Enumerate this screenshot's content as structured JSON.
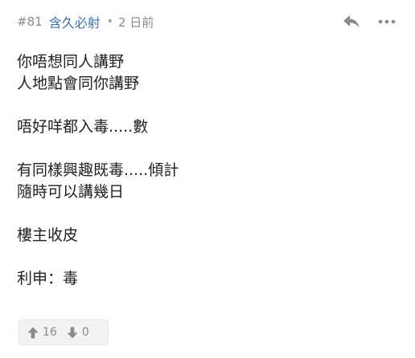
{
  "post": {
    "number": "#81",
    "username": "含久必射",
    "separator": "•",
    "timestamp": "2 日前"
  },
  "actions": {
    "reply_icon": "reply-icon",
    "more_icon": "more-icon"
  },
  "content": {
    "paragraphs": [
      [
        "你唔想同人講野",
        "人地點會同你講野"
      ],
      [
        "唔好咩都入毒.....數"
      ],
      [
        "有同樣興趣既毒.....傾計",
        "隨時可以講幾日"
      ],
      [
        "樓主收皮"
      ],
      [
        "利申：毒"
      ]
    ]
  },
  "votes": {
    "up_count": "16",
    "down_count": "0",
    "up_icon": "arrow-up-icon",
    "down_icon": "arrow-down-icon"
  },
  "colors": {
    "username": "#3f74a8",
    "meta": "#8a8a8a",
    "text": "#222222",
    "vote_bg": "#f2f2f2"
  }
}
